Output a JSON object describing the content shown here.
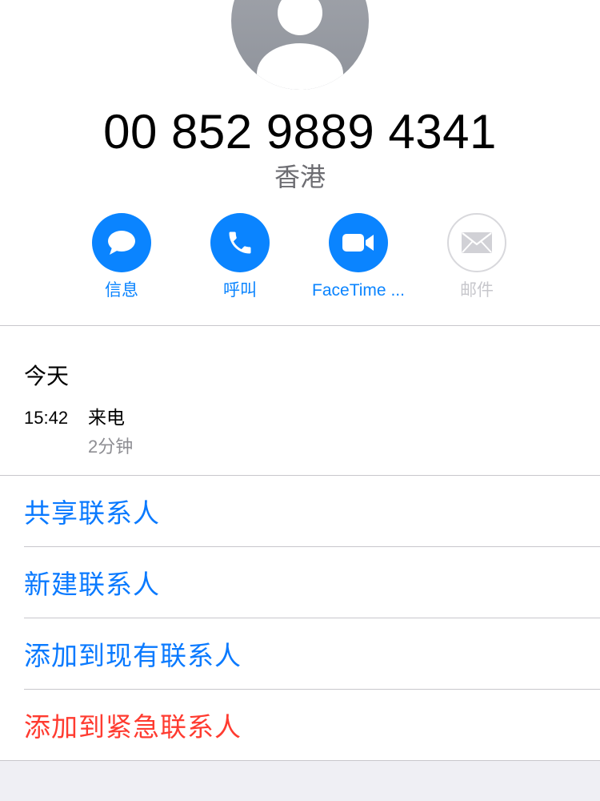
{
  "contact": {
    "phone_number": "00 852 9889 4341",
    "region": "香港",
    "avatar_icon": "person-silhouette-icon"
  },
  "actions": {
    "message": {
      "label": "信息",
      "icon": "message-bubble-icon"
    },
    "call": {
      "label": "呼叫",
      "icon": "phone-icon"
    },
    "facetime": {
      "label": "FaceTime ...",
      "icon": "video-camera-icon"
    },
    "mail": {
      "label": "邮件",
      "icon": "envelope-icon"
    }
  },
  "recents": {
    "date_header": "今天",
    "call_time": "15:42",
    "call_type": "来电",
    "call_duration": "2分钟"
  },
  "options": {
    "share_contact": "共享联系人",
    "new_contact": "新建联系人",
    "add_to_existing": "添加到现有联系人",
    "add_to_emergency": "添加到紧急联系人"
  },
  "colors": {
    "accent": "#0a84ff",
    "link": "#0a7aff",
    "danger": "#ff3b30",
    "disabled": "#c7c7cc",
    "secondary_text": "#8e8e93"
  }
}
